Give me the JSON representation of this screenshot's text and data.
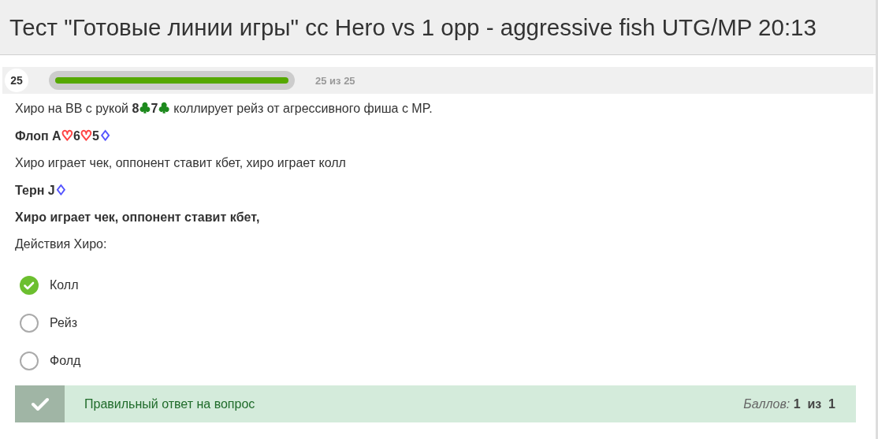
{
  "title": "Тест \"Готовые линии игры\" cc Hero vs 1 opp - aggressive fish UTG/MP 20:13",
  "progress": {
    "number": "25",
    "reading": "25 из 25"
  },
  "question": [
    {
      "parts": [
        {
          "text": "Хиро на BB с рукой "
        },
        {
          "text": "8",
          "bold": true
        },
        {
          "text": "♣",
          "color": "#1e8a1e"
        },
        {
          "text": "7",
          "bold": true
        },
        {
          "text": "♣",
          "color": "#1e8a1e"
        },
        {
          "text": " коллирует рейз от  агрессивного фиша с MP."
        }
      ]
    },
    {
      "parts": [
        {
          "text": "Флоп A",
          "bold": true
        },
        {
          "text": "♡",
          "color": "#ff4444"
        },
        {
          "text": "6",
          "bold": true
        },
        {
          "text": "♡",
          "color": "#ff4444"
        },
        {
          "text": "5",
          "bold": true
        },
        {
          "text": "♢",
          "color": "#5555ff"
        }
      ]
    },
    {
      "parts": [
        {
          "text": "Хиро играет чек, оппонент ставит кбет, хиро играет колл"
        }
      ]
    },
    {
      "parts": [
        {
          "text": "Терн J",
          "bold": true
        },
        {
          "text": "♢",
          "color": "#5555ff"
        }
      ]
    },
    {
      "parts": [
        {
          "text": "Хиро играет чек, оппонент ставит кбет,",
          "bold": true
        }
      ]
    },
    {
      "parts": [
        {
          "text": "Действия Хиро:"
        }
      ]
    }
  ],
  "options": [
    {
      "label": "Колл",
      "selected": true
    },
    {
      "label": "Рейз",
      "selected": false
    },
    {
      "label": "Фолд",
      "selected": false
    }
  ],
  "feedback": {
    "correct": true,
    "message": "Правильный ответ на вопрос",
    "score": "*Баллов:* **1  из  1**"
  }
}
